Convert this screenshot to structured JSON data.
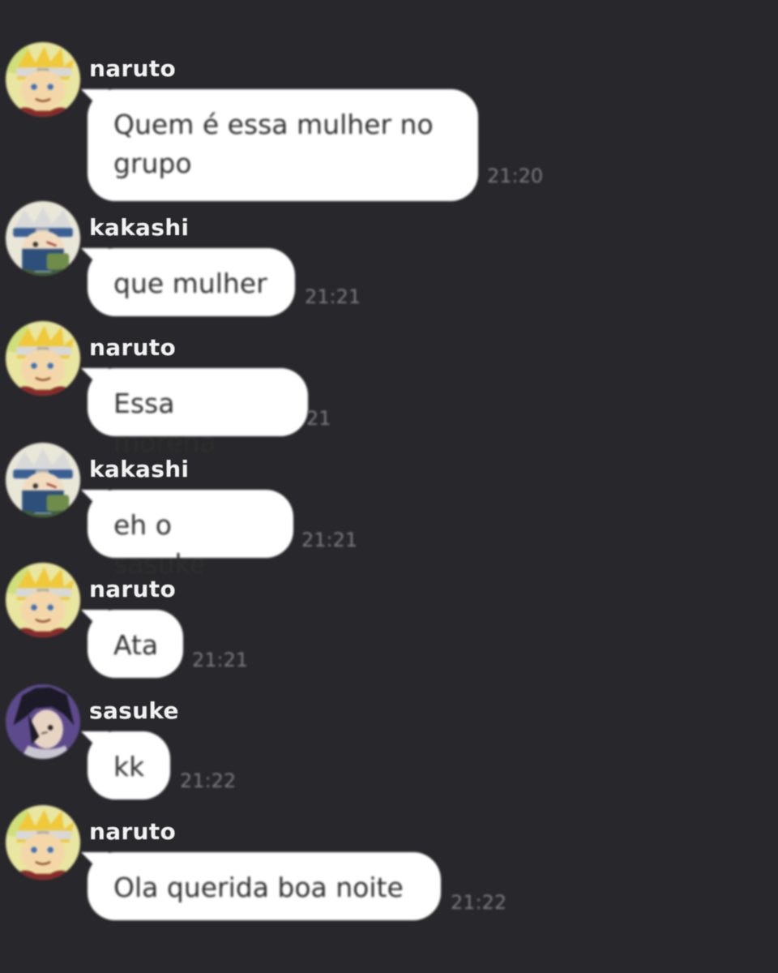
{
  "colors": {
    "background": "#28272b",
    "bubble": "#ffffff",
    "bubble_text": "#2e2e2e",
    "sender_text": "#f2f2f2",
    "timestamp_text": "#7d7c80"
  },
  "messages": [
    {
      "sender": "naruto",
      "avatar_icon": "naruto-avatar-icon",
      "text": "Quem é essa mulher no grupo",
      "time": "21:20"
    },
    {
      "sender": "kakashi",
      "avatar_icon": "kakashi-avatar-icon",
      "text": "que mulher",
      "time": "21:21"
    },
    {
      "sender": "naruto",
      "avatar_icon": "naruto-avatar-icon",
      "text": "Essa morena",
      "time": "21"
    },
    {
      "sender": "kakashi",
      "avatar_icon": "kakashi-avatar-icon",
      "text": "eh o sasuke",
      "time": "21:21"
    },
    {
      "sender": "naruto",
      "avatar_icon": "naruto-avatar-icon",
      "text": "Ata",
      "time": "21:21"
    },
    {
      "sender": "sasuke",
      "avatar_icon": "sasuke-avatar-icon",
      "text": "kk",
      "time": "21:22"
    },
    {
      "sender": "naruto",
      "avatar_icon": "naruto-avatar-icon",
      "text": "Ola querida boa noite",
      "time": "21:22"
    }
  ]
}
